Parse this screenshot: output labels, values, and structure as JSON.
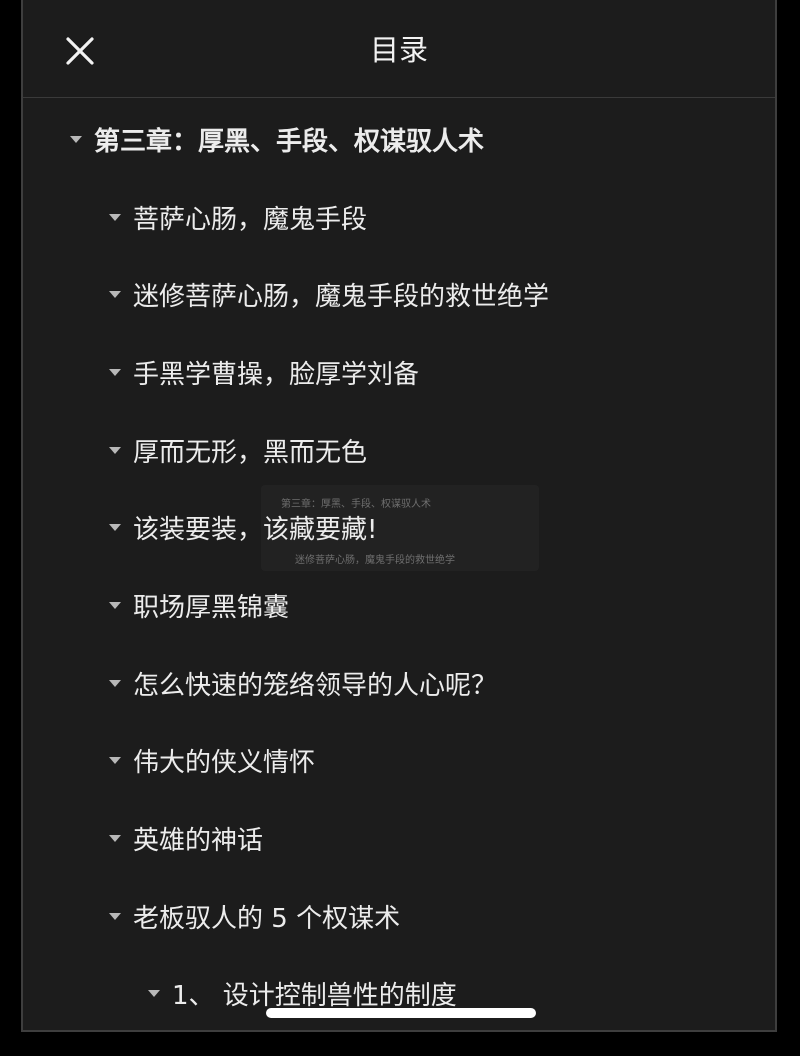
{
  "header": {
    "title": "目录",
    "close_icon": "close-icon"
  },
  "toc": {
    "chapter": "第三章：厚黑、手段、权谋驭人术",
    "items": [
      "菩萨心肠，魔鬼手段",
      "迷修菩萨心肠，魔鬼手段的救世绝学",
      "手黑学曹操，脸厚学刘备",
      "厚而无形，黑而无色",
      "该装要装，该藏要藏!",
      "职场厚黑锦囊",
      "怎么快速的笼络领导的人心呢？",
      "伟大的侠义情怀",
      "英雄的神话",
      "老板驭人的 5 个权谋术"
    ],
    "subitem": "1、 设计控制兽性的制度"
  },
  "drag_preview": {
    "line1": "第三章：厚黑、手段、权谋驭人术",
    "line2": "迷修菩萨心肠，魔鬼手段的救世绝学"
  },
  "colors": {
    "background": "#1c1c1c",
    "text": "#ececec",
    "caret": "#b8b8b8"
  }
}
